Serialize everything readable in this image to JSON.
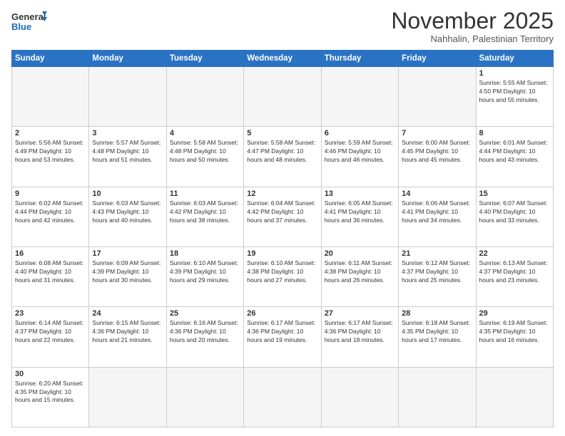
{
  "logo": {
    "text_general": "General",
    "text_blue": "Blue"
  },
  "header": {
    "month_title": "November 2025",
    "subtitle": "Nahhalin, Palestinian Territory"
  },
  "weekdays": [
    "Sunday",
    "Monday",
    "Tuesday",
    "Wednesday",
    "Thursday",
    "Friday",
    "Saturday"
  ],
  "weeks": [
    [
      {
        "day": "",
        "info": ""
      },
      {
        "day": "",
        "info": ""
      },
      {
        "day": "",
        "info": ""
      },
      {
        "day": "",
        "info": ""
      },
      {
        "day": "",
        "info": ""
      },
      {
        "day": "",
        "info": ""
      },
      {
        "day": "1",
        "info": "Sunrise: 5:55 AM\nSunset: 4:50 PM\nDaylight: 10 hours and 55 minutes."
      }
    ],
    [
      {
        "day": "2",
        "info": "Sunrise: 5:56 AM\nSunset: 4:49 PM\nDaylight: 10 hours and 53 minutes."
      },
      {
        "day": "3",
        "info": "Sunrise: 5:57 AM\nSunset: 4:48 PM\nDaylight: 10 hours and 51 minutes."
      },
      {
        "day": "4",
        "info": "Sunrise: 5:58 AM\nSunset: 4:48 PM\nDaylight: 10 hours and 50 minutes."
      },
      {
        "day": "5",
        "info": "Sunrise: 5:58 AM\nSunset: 4:47 PM\nDaylight: 10 hours and 48 minutes."
      },
      {
        "day": "6",
        "info": "Sunrise: 5:59 AM\nSunset: 4:46 PM\nDaylight: 10 hours and 46 minutes."
      },
      {
        "day": "7",
        "info": "Sunrise: 6:00 AM\nSunset: 4:45 PM\nDaylight: 10 hours and 45 minutes."
      },
      {
        "day": "8",
        "info": "Sunrise: 6:01 AM\nSunset: 4:44 PM\nDaylight: 10 hours and 43 minutes."
      }
    ],
    [
      {
        "day": "9",
        "info": "Sunrise: 6:02 AM\nSunset: 4:44 PM\nDaylight: 10 hours and 42 minutes."
      },
      {
        "day": "10",
        "info": "Sunrise: 6:03 AM\nSunset: 4:43 PM\nDaylight: 10 hours and 40 minutes."
      },
      {
        "day": "11",
        "info": "Sunrise: 6:03 AM\nSunset: 4:42 PM\nDaylight: 10 hours and 38 minutes."
      },
      {
        "day": "12",
        "info": "Sunrise: 6:04 AM\nSunset: 4:42 PM\nDaylight: 10 hours and 37 minutes."
      },
      {
        "day": "13",
        "info": "Sunrise: 6:05 AM\nSunset: 4:41 PM\nDaylight: 10 hours and 36 minutes."
      },
      {
        "day": "14",
        "info": "Sunrise: 6:06 AM\nSunset: 4:41 PM\nDaylight: 10 hours and 34 minutes."
      },
      {
        "day": "15",
        "info": "Sunrise: 6:07 AM\nSunset: 4:40 PM\nDaylight: 10 hours and 33 minutes."
      }
    ],
    [
      {
        "day": "16",
        "info": "Sunrise: 6:08 AM\nSunset: 4:40 PM\nDaylight: 10 hours and 31 minutes."
      },
      {
        "day": "17",
        "info": "Sunrise: 6:09 AM\nSunset: 4:39 PM\nDaylight: 10 hours and 30 minutes."
      },
      {
        "day": "18",
        "info": "Sunrise: 6:10 AM\nSunset: 4:39 PM\nDaylight: 10 hours and 29 minutes."
      },
      {
        "day": "19",
        "info": "Sunrise: 6:10 AM\nSunset: 4:38 PM\nDaylight: 10 hours and 27 minutes."
      },
      {
        "day": "20",
        "info": "Sunrise: 6:11 AM\nSunset: 4:38 PM\nDaylight: 10 hours and 26 minutes."
      },
      {
        "day": "21",
        "info": "Sunrise: 6:12 AM\nSunset: 4:37 PM\nDaylight: 10 hours and 25 minutes."
      },
      {
        "day": "22",
        "info": "Sunrise: 6:13 AM\nSunset: 4:37 PM\nDaylight: 10 hours and 23 minutes."
      }
    ],
    [
      {
        "day": "23",
        "info": "Sunrise: 6:14 AM\nSunset: 4:37 PM\nDaylight: 10 hours and 22 minutes."
      },
      {
        "day": "24",
        "info": "Sunrise: 6:15 AM\nSunset: 4:36 PM\nDaylight: 10 hours and 21 minutes."
      },
      {
        "day": "25",
        "info": "Sunrise: 6:16 AM\nSunset: 4:36 PM\nDaylight: 10 hours and 20 minutes."
      },
      {
        "day": "26",
        "info": "Sunrise: 6:17 AM\nSunset: 4:36 PM\nDaylight: 10 hours and 19 minutes."
      },
      {
        "day": "27",
        "info": "Sunrise: 6:17 AM\nSunset: 4:36 PM\nDaylight: 10 hours and 18 minutes."
      },
      {
        "day": "28",
        "info": "Sunrise: 6:18 AM\nSunset: 4:35 PM\nDaylight: 10 hours and 17 minutes."
      },
      {
        "day": "29",
        "info": "Sunrise: 6:19 AM\nSunset: 4:35 PM\nDaylight: 10 hours and 16 minutes."
      }
    ],
    [
      {
        "day": "30",
        "info": "Sunrise: 6:20 AM\nSunset: 4:35 PM\nDaylight: 10 hours and 15 minutes."
      },
      {
        "day": "",
        "info": ""
      },
      {
        "day": "",
        "info": ""
      },
      {
        "day": "",
        "info": ""
      },
      {
        "day": "",
        "info": ""
      },
      {
        "day": "",
        "info": ""
      },
      {
        "day": "",
        "info": ""
      }
    ]
  ]
}
